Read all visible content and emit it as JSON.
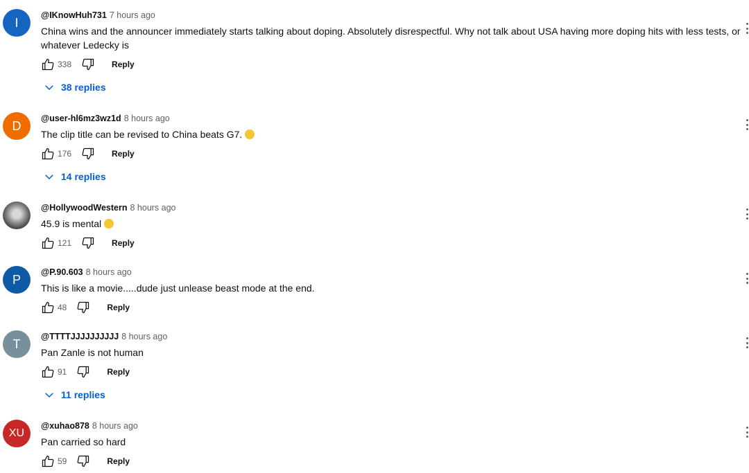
{
  "comments": [
    {
      "avatar_letter": "I",
      "avatar_color": "#1565c0",
      "author": "@IKnowHuh731",
      "time": "7 hours ago",
      "text": "China wins and the announcer immediately starts talking about doping. Absolutely disrespectful. Why not talk about USA having more doping hits with less tests, or whatever Ledecky is",
      "likes": "338",
      "reply_label": "Reply",
      "replies": "38 replies"
    },
    {
      "avatar_letter": "D",
      "avatar_color": "#ef6c00",
      "author": "@user-hl6mz3wz1d",
      "time": "8 hours ago",
      "text": "The clip title can be revised to China beats G7.",
      "emoji": "grinning-face",
      "likes": "176",
      "reply_label": "Reply",
      "replies": "14 replies"
    },
    {
      "avatar_letter": "",
      "avatar_image": "wolf-photo",
      "author": "@HollywoodWestern",
      "time": "8 hours ago",
      "text": "45.9 is mental",
      "emoji": "astonished-face",
      "likes": "121",
      "reply_label": "Reply"
    },
    {
      "avatar_letter": "P",
      "avatar_color": "#0d5aa7",
      "author": "@P.90.603",
      "time": "8 hours ago",
      "text": "This is like a movie.....dude just unlease beast mode at the end.",
      "likes": "48",
      "reply_label": "Reply"
    },
    {
      "avatar_letter": "T",
      "avatar_color": "#78909c",
      "author": "@TTTTJJJJJJJJJJ",
      "time": "8 hours ago",
      "text": "Pan Zanle is not human",
      "likes": "91",
      "reply_label": "Reply",
      "replies": "11 replies"
    },
    {
      "avatar_letter": "XU",
      "avatar_color": "#c62828",
      "author": "@xuhao878",
      "time": "8 hours ago",
      "text": "Pan carried so hard",
      "likes": "59",
      "reply_label": "Reply"
    }
  ]
}
